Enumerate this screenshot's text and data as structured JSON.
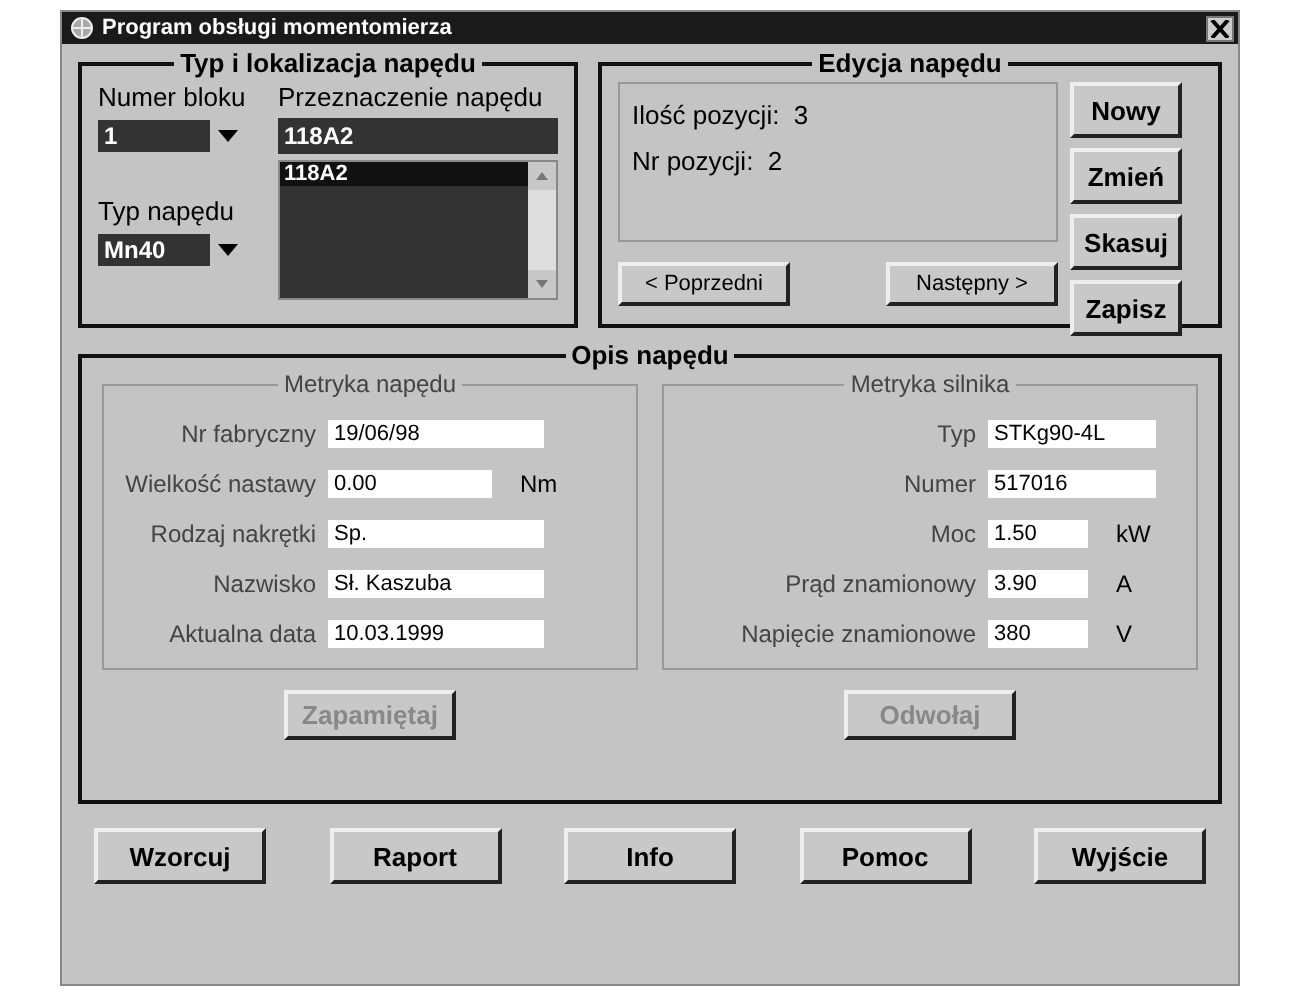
{
  "window": {
    "title": "Program obsługi momentomierza"
  },
  "typ_group": {
    "title": "Typ i lokalizacja napędu",
    "numer_bloku": {
      "label": "Numer bloku",
      "value": "1"
    },
    "typ_napedu": {
      "label": "Typ napędu",
      "value": "Mn40"
    },
    "przeznaczenie": {
      "label": "Przeznaczenie napędu",
      "value": "118A2",
      "items": [
        {
          "text": "118A2",
          "selected": true
        }
      ]
    }
  },
  "edycja_group": {
    "title": "Edycja napędu",
    "lines": [
      "Ilość pozycji:  3",
      "Nr pozycji:  2"
    ],
    "nav_buttons": [
      {
        "label": "< Poprzedni",
        "disabled": false
      },
      {
        "label": "Następny >",
        "disabled": false
      }
    ],
    "side_buttons": [
      {
        "label": "Nowy",
        "disabled": false
      },
      {
        "label": "Zmień",
        "disabled": false
      },
      {
        "label": "Skasuj",
        "disabled": false
      },
      {
        "label": "Zapisz",
        "disabled": false
      }
    ]
  },
  "opis_group": {
    "title": "Opis napędu",
    "panels": [
      {
        "title": "Metryka napędu",
        "fields": [
          {
            "label": "Nr fabryczny",
            "value": "19/06/98"
          },
          {
            "label": "Wielkość nastawy",
            "value": "0.00",
            "unit": "Nm"
          },
          {
            "label": "Rodzaj nakrętki",
            "value": "Sp."
          },
          {
            "label": "Nazwisko",
            "value": "Sł. Kaszuba"
          },
          {
            "label": "Aktualna data",
            "value": "10.03.1999"
          }
        ],
        "button": {
          "label": "Zapamiętaj",
          "disabled": true
        }
      },
      {
        "title": "Metryka silnika",
        "fields": [
          {
            "label": "Typ",
            "value": "STKg90-4L"
          },
          {
            "label": "Numer",
            "value": "517016"
          },
          {
            "label": "Moc",
            "value": "1.50",
            "unit": "kW"
          },
          {
            "label": "Prąd znamionowy",
            "value": "3.90",
            "unit": "A"
          },
          {
            "label": "Napięcie znamionowe",
            "value": "380",
            "unit": "V"
          }
        ],
        "button": {
          "label": "Odwołaj",
          "disabled": true
        }
      }
    ]
  },
  "bottom_buttons": [
    {
      "label": "Wzorcuj",
      "disabled": false
    },
    {
      "label": "Raport",
      "disabled": false
    },
    {
      "label": "Info",
      "disabled": false
    },
    {
      "label": "Pomoc",
      "disabled": false
    },
    {
      "label": "Wyjście",
      "disabled": false
    }
  ]
}
